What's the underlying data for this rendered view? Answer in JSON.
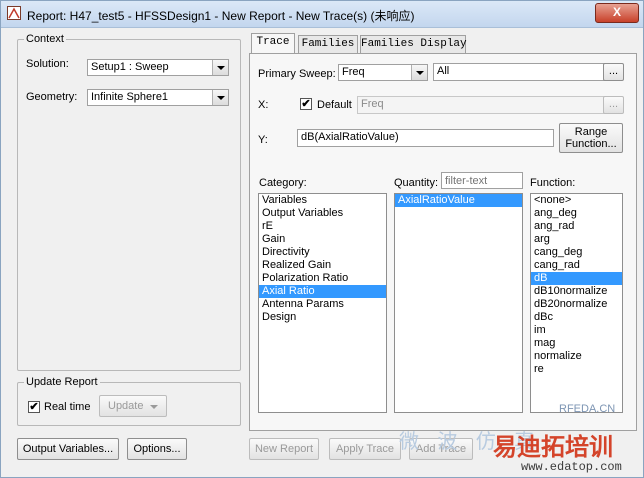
{
  "window": {
    "title": "Report: H47_test5 - HFSSDesign1 - New Report - New Trace(s) (未响应)",
    "close_label": "X"
  },
  "context": {
    "legend": "Context",
    "solution_label": "Solution:",
    "solution_value": "Setup1 : Sweep",
    "geometry_label": "Geometry:",
    "geometry_value": "Infinite Sphere1"
  },
  "update_report": {
    "legend": "Update Report",
    "realtime_label": "Real time",
    "realtime_checked": "✔",
    "update_label": "Update"
  },
  "footer": {
    "output_variables": "Output Variables...",
    "options": "Options...",
    "new_report": "New Report",
    "apply_trace": "Apply Trace",
    "add_trace": "Add Trace"
  },
  "tabs": [
    {
      "label": "Trace"
    },
    {
      "label": "Families"
    },
    {
      "label": "Families Display"
    }
  ],
  "trace": {
    "primary_sweep_label": "Primary Sweep:",
    "primary_sweep_value": "Freq",
    "primary_sweep_range": "All",
    "ellipsis": "...",
    "x_label": "X:",
    "default_label": "Default",
    "default_checked": "✔",
    "x_value": "Freq",
    "y_label": "Y:",
    "y_value": "dB(AxialRatioValue)",
    "range_function_line1": "Range",
    "range_function_line2": "Function..."
  },
  "category": {
    "label": "Category:",
    "items": [
      "Variables",
      "Output Variables",
      "rE",
      "Gain",
      "Directivity",
      "Realized Gain",
      "Polarization Ratio",
      "Axial Ratio",
      "Antenna Params",
      "Design"
    ],
    "selected": "Axial Ratio"
  },
  "quantity": {
    "label": "Quantity:",
    "filter_placeholder": "filter-text",
    "items": [
      "AxialRatioValue"
    ],
    "selected": "AxialRatioValue"
  },
  "function": {
    "label": "Function:",
    "items": [
      "<none>",
      "ang_deg",
      "ang_rad",
      "arg",
      "cang_deg",
      "cang_rad",
      "dB",
      "dB10normalize",
      "dB20normalize",
      "dBc",
      "im",
      "mag",
      "normalize",
      "re"
    ],
    "selected": "dB"
  },
  "watermark": {
    "site1": "RFEDA.CN",
    "site2": "www.edatop.com",
    "brand": "易迪拓培训",
    "faint": "微 波 仿 真"
  },
  "colors": {
    "selection": "#3399ff",
    "close_button": "#c8412a",
    "watermark_brand": "#d4442a"
  }
}
